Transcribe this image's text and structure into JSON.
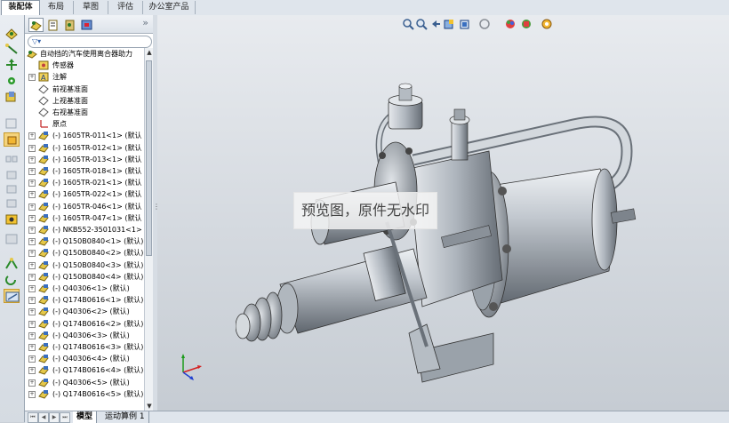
{
  "tabs": {
    "items": [
      "装配体",
      "布局",
      "草图",
      "评估",
      "办公室产品"
    ],
    "active_index": 0
  },
  "feature_manager": {
    "tabs": [
      "feature-manager-icon",
      "property-manager-icon",
      "configuration-manager-icon",
      "dimxpert-icon"
    ],
    "more": "»",
    "filter_icon": "filter-icon",
    "root_label": "自动挡的汽车使用离合器助力",
    "items": [
      {
        "type": "sensors",
        "label": "传感器",
        "expander": false
      },
      {
        "type": "annotations",
        "label": "注解",
        "expander": true
      },
      {
        "type": "plane",
        "label": "前视基准面",
        "expander": false
      },
      {
        "type": "plane",
        "label": "上视基准面",
        "expander": false
      },
      {
        "type": "plane",
        "label": "右视基准面",
        "expander": false
      },
      {
        "type": "origin",
        "label": "原点",
        "expander": false
      },
      {
        "type": "part",
        "label": "(-) 1605TR-011<1> (默认",
        "expander": true
      },
      {
        "type": "part",
        "label": "(-) 1605TR-012<1> (默认",
        "expander": true
      },
      {
        "type": "part",
        "label": "(-) 1605TR-013<1> (默认",
        "expander": true
      },
      {
        "type": "part",
        "label": "(-) 1605TR-018<1> (默认",
        "expander": true
      },
      {
        "type": "part",
        "label": "(-) 1605TR-021<1> (默认",
        "expander": true
      },
      {
        "type": "part",
        "label": "(-) 1605TR-022<1> (默认",
        "expander": true
      },
      {
        "type": "part",
        "label": "(-) 1605TR-046<1> (默认",
        "expander": true
      },
      {
        "type": "part",
        "label": "(-) 1605TR-047<1> (默认",
        "expander": true
      },
      {
        "type": "part",
        "label": "(-) NKB552-3501031<1> <",
        "expander": true
      },
      {
        "type": "part",
        "label": "(-) Q150B0840<1> (默认)",
        "expander": true
      },
      {
        "type": "part",
        "label": "(-) Q150B0840<2> (默认)",
        "expander": true
      },
      {
        "type": "part",
        "label": "(-) Q150B0840<3> (默认)",
        "expander": true
      },
      {
        "type": "part",
        "label": "(-) Q150B0840<4> (默认)",
        "expander": true
      },
      {
        "type": "part",
        "label": "(-) Q40306<1> (默认)",
        "expander": true
      },
      {
        "type": "part",
        "label": "(-) Q174B0616<1> (默认)",
        "expander": true
      },
      {
        "type": "part",
        "label": "(-) Q40306<2> (默认)",
        "expander": true
      },
      {
        "type": "part",
        "label": "(-) Q174B0616<2> (默认)",
        "expander": true
      },
      {
        "type": "part",
        "label": "(-) Q40306<3> (默认)",
        "expander": true
      },
      {
        "type": "part",
        "label": "(-) Q174B0616<3> (默认)",
        "expander": true
      },
      {
        "type": "part",
        "label": "(-) Q40306<4> (默认)",
        "expander": true
      },
      {
        "type": "part",
        "label": "(-) Q174B0616<4> (默认)",
        "expander": true
      },
      {
        "type": "part",
        "label": "(-) Q40306<5> (默认)",
        "expander": true
      },
      {
        "type": "part",
        "label": "(-) Q174B0616<5> (默认)",
        "expander": true
      }
    ]
  },
  "bottom_tabs": {
    "items": [
      "模型",
      "运动算例 1"
    ],
    "active_index": 0
  },
  "heads_up_toolbar": [
    "zoom-to-fit-icon",
    "zoom-to-area-icon",
    "previous-view-icon",
    "section-view-icon",
    "view-orientation-icon",
    "display-style-icon",
    "hide-show-items-icon",
    "edit-appearance-icon",
    "apply-scene-icon",
    "view-settings-icon"
  ],
  "viewport": {
    "watermark_text": "预览图，原件无水印",
    "triad_axes": [
      "x",
      "y",
      "z"
    ]
  },
  "colors": {
    "metal_light": "#cdd3d9",
    "metal_dark": "#5f666e",
    "axis_x": "#d42020",
    "axis_y": "#1a9a1a",
    "axis_z": "#2040d0",
    "selected_tool": "#f4d37c"
  }
}
